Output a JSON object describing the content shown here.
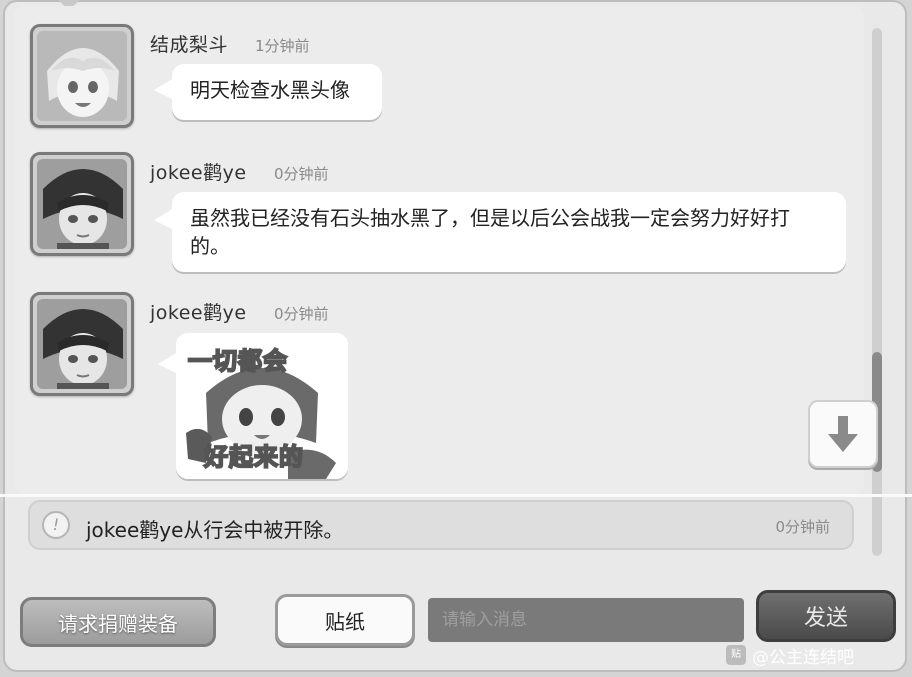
{
  "messages": [
    {
      "name": "结成梨斗",
      "time": "1分钟前",
      "text": "明天检查水黑头像"
    },
    {
      "name": "jokee鹳ye",
      "time": "0分钟前",
      "text": "虽然我已经没有石头抽水黑了，但是以后公会战我一定会努力好好打的。"
    },
    {
      "name": "jokee鹳ye",
      "time": "0分钟前",
      "sticker_line1": "一切都会",
      "sticker_line2": "好起来的"
    }
  ],
  "system_message": {
    "text": "jokee鹳ye从行会中被开除。",
    "time": "0分钟前",
    "icon": "exclamation-icon"
  },
  "buttons": {
    "donate": "请求捐赠装备",
    "sticker": "贴纸",
    "send": "发送"
  },
  "input": {
    "placeholder": "请输入消息"
  },
  "watermark": {
    "text": "@公主连结吧",
    "logo": "贴"
  },
  "colors": {
    "send_button": "#4a4a4a",
    "panel": "#ececec"
  }
}
